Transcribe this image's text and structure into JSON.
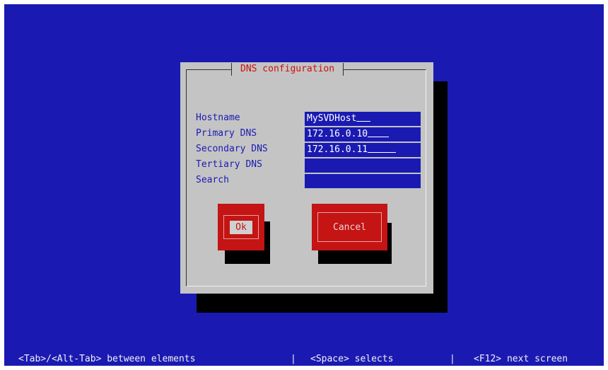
{
  "dialog": {
    "title": "DNS configuration",
    "fields": [
      {
        "label": "Hostname",
        "value": "MySVDHost",
        "underline": "  "
      },
      {
        "label": "Primary DNS",
        "value": "172.16.0.10",
        "underline": " "
      },
      {
        "label": "Secondary DNS",
        "value": "172.16.0.11",
        "underline": "    "
      },
      {
        "label": "Tertiary DNS",
        "value": "",
        "underline": ""
      },
      {
        "label": "Search",
        "value": "",
        "underline": ""
      }
    ],
    "ok_label": "Ok",
    "cancel_label": "Cancel"
  },
  "status_bar": {
    "nav_hint": "<Tab>/<Alt-Tab> between elements",
    "separator_1": "|",
    "select_hint": "<Space> selects",
    "separator_2": "|",
    "next_hint": "<F12> next screen"
  },
  "colors": {
    "screen_background": "#1a1ab3",
    "dialog_background": "#c4c4c4",
    "title_text": "#c81010",
    "button_background": "#c41414"
  }
}
